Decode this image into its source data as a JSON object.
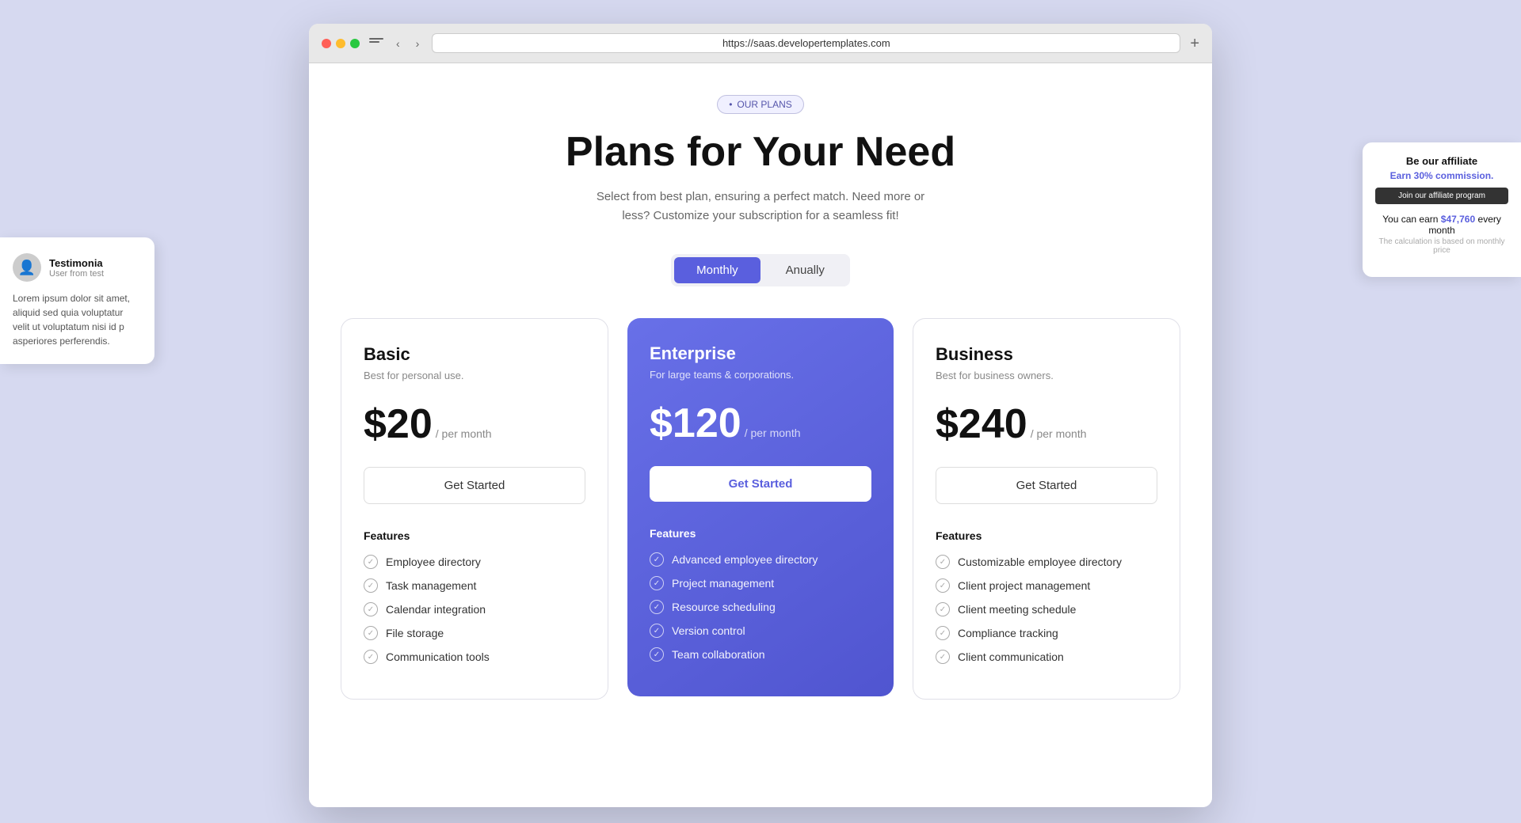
{
  "browser": {
    "url": "https://saas.developertemplates.com",
    "new_tab_label": "+"
  },
  "header": {
    "badge": "OUR PLANS",
    "title": "Plans for Your Need",
    "subtitle": "Select from best plan, ensuring a perfect match. Need more or less? Customize your subscription for a seamless fit!",
    "billing_toggle": {
      "monthly_label": "Monthly",
      "annually_label": "Anually",
      "active": "monthly"
    }
  },
  "plans": [
    {
      "id": "basic",
      "name": "Basic",
      "description": "Best for personal use.",
      "price": "$20",
      "period": "/ per month",
      "cta": "Get Started",
      "featured": false,
      "features_label": "Features",
      "features": [
        "Employee directory",
        "Task management",
        "Calendar integration",
        "File storage",
        "Communication tools"
      ]
    },
    {
      "id": "enterprise",
      "name": "Enterprise",
      "description": "For large teams & corporations.",
      "price": "$120",
      "period": "/ per month",
      "cta": "Get Started",
      "featured": true,
      "features_label": "Features",
      "features": [
        "Advanced employee directory",
        "Project management",
        "Resource scheduling",
        "Version control",
        "Team collaboration"
      ]
    },
    {
      "id": "business",
      "name": "Business",
      "description": "Best for business owners.",
      "price": "$240",
      "period": "/ per month",
      "cta": "Get Started",
      "featured": false,
      "features_label": "Features",
      "features": [
        "Customizable employee directory",
        "Client project management",
        "Client meeting schedule",
        "Compliance tracking",
        "Client communication"
      ]
    }
  ],
  "testimonial": {
    "name": "Testimonia",
    "role": "User from test",
    "text": "Lorem ipsum dolor sit amet, aliquid sed quia voluptatur velit ut voluptatum nisi id p asperiores perferendis."
  },
  "affiliate": {
    "headline": "Be our affiliate",
    "commission": "Earn 30% commission.",
    "join_label": "Join our affiliate program",
    "earn_text": "You can earn",
    "earn_amount": "$47,760",
    "earn_period": "every month",
    "earn_note": "The calculation is based on monthly price"
  }
}
